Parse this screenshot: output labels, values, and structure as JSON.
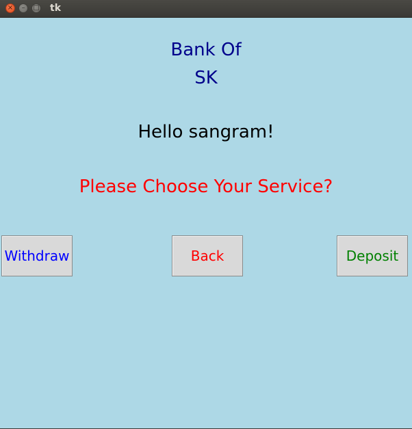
{
  "window": {
    "title": "tk"
  },
  "header": {
    "bank_line1": "Bank Of",
    "bank_line2": "SK",
    "greeting": "Hello sangram!",
    "prompt": "Please Choose Your Service?"
  },
  "buttons": {
    "withdraw": "Withdraw",
    "back": "Back",
    "deposit": "Deposit"
  },
  "colors": {
    "background": "#ADD8E6",
    "bank_text": "#00008B",
    "greeting_text": "#000000",
    "prompt_text": "#FF0000",
    "withdraw_text": "#0000FF",
    "back_text": "#FF0000",
    "deposit_text": "#008000"
  },
  "icons": {
    "close": "close-icon",
    "minimize": "minimize-icon",
    "maximize": "maximize-icon"
  }
}
